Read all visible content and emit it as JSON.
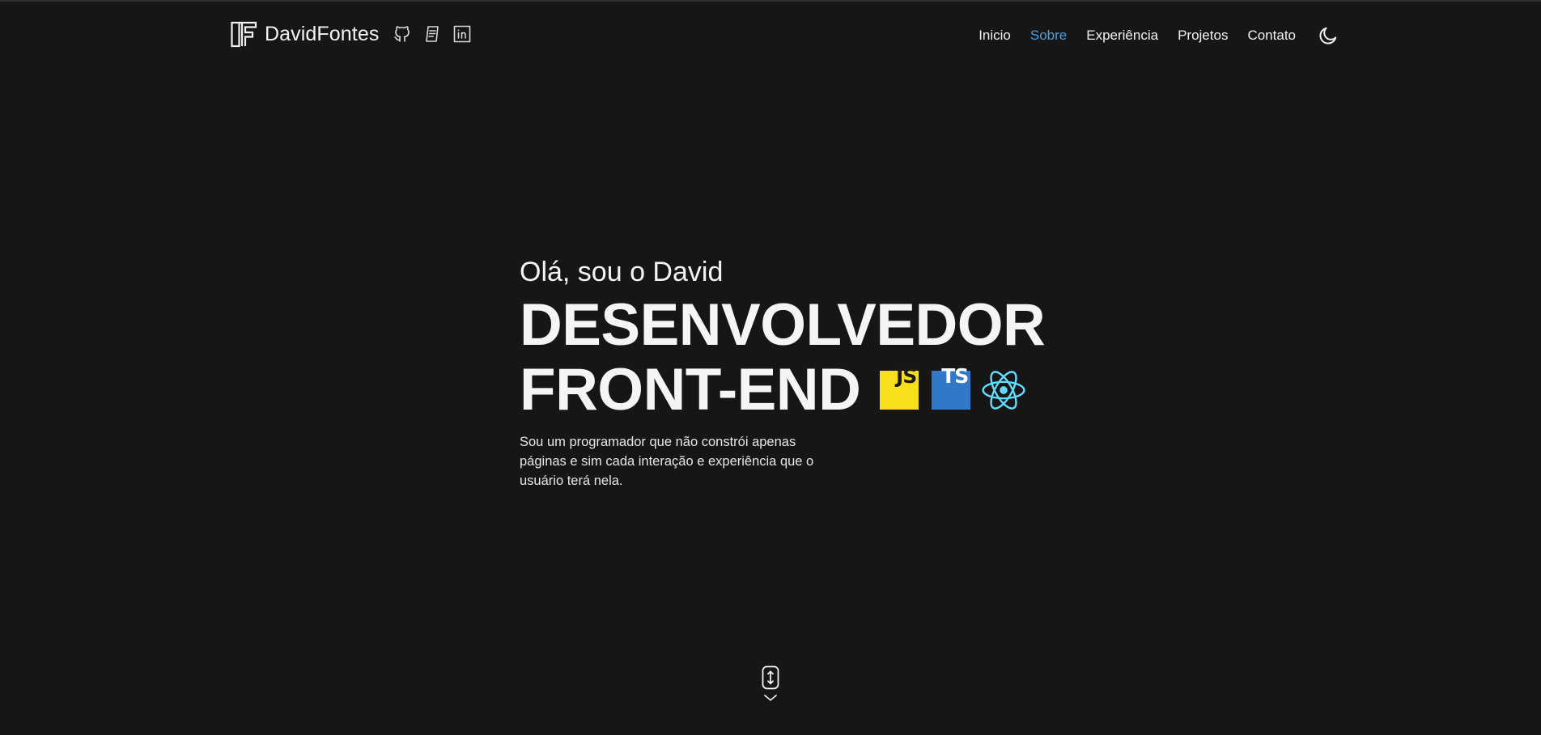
{
  "brand": {
    "name": "DavidFontes",
    "socials": [
      {
        "icon": "github-icon"
      },
      {
        "icon": "resume-icon"
      },
      {
        "icon": "linkedin-icon"
      }
    ]
  },
  "nav": {
    "items": [
      {
        "label": "Inicio",
        "active": false
      },
      {
        "label": "Sobre",
        "active": true
      },
      {
        "label": "Experiência",
        "active": false
      },
      {
        "label": "Projetos",
        "active": false
      },
      {
        "label": "Contato",
        "active": false
      }
    ],
    "theme_icon": "moon-icon"
  },
  "hero": {
    "greeting": "Olá, sou o David",
    "title_line1": "DESENVOLVEDOR",
    "title_line2": "FRONT-END",
    "tech": [
      {
        "label": "JS",
        "color": "#f7df1e",
        "icon": "javascript-icon"
      },
      {
        "label": "TS",
        "color": "#3178c6",
        "icon": "typescript-icon"
      },
      {
        "icon": "react-icon",
        "color": "#61dafb"
      }
    ],
    "description": "Sou um programador que não constrói apenas páginas e sim cada interação e experiência que o usuário terá nela."
  },
  "colors": {
    "background": "#161616",
    "text": "#f2f2f2",
    "accent": "#4a9fe0"
  },
  "scroll_hint": {
    "icon": "mouse-scroll-icon",
    "arrow": "chevron-down-icon"
  }
}
